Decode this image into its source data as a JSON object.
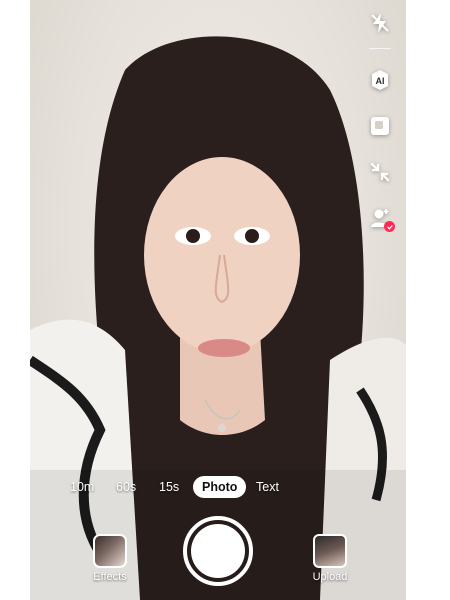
{
  "toolbar": {
    "items": [
      {
        "icon": "flash-off-icon"
      },
      {
        "icon": "ai-icon",
        "text": "AI"
      },
      {
        "icon": "square-icon"
      },
      {
        "icon": "collapse-icon"
      },
      {
        "icon": "add-person-icon"
      }
    ]
  },
  "modes": {
    "tabs": [
      "10m",
      "60s",
      "15s",
      "Photo",
      "Text"
    ],
    "active": "Photo"
  },
  "bottom": {
    "effects_label": "Effects",
    "upload_label": "Upload"
  },
  "colors": {
    "accent": "#fe2c55",
    "active_tab_bg": "#ffffff",
    "text": "#ffffff"
  }
}
